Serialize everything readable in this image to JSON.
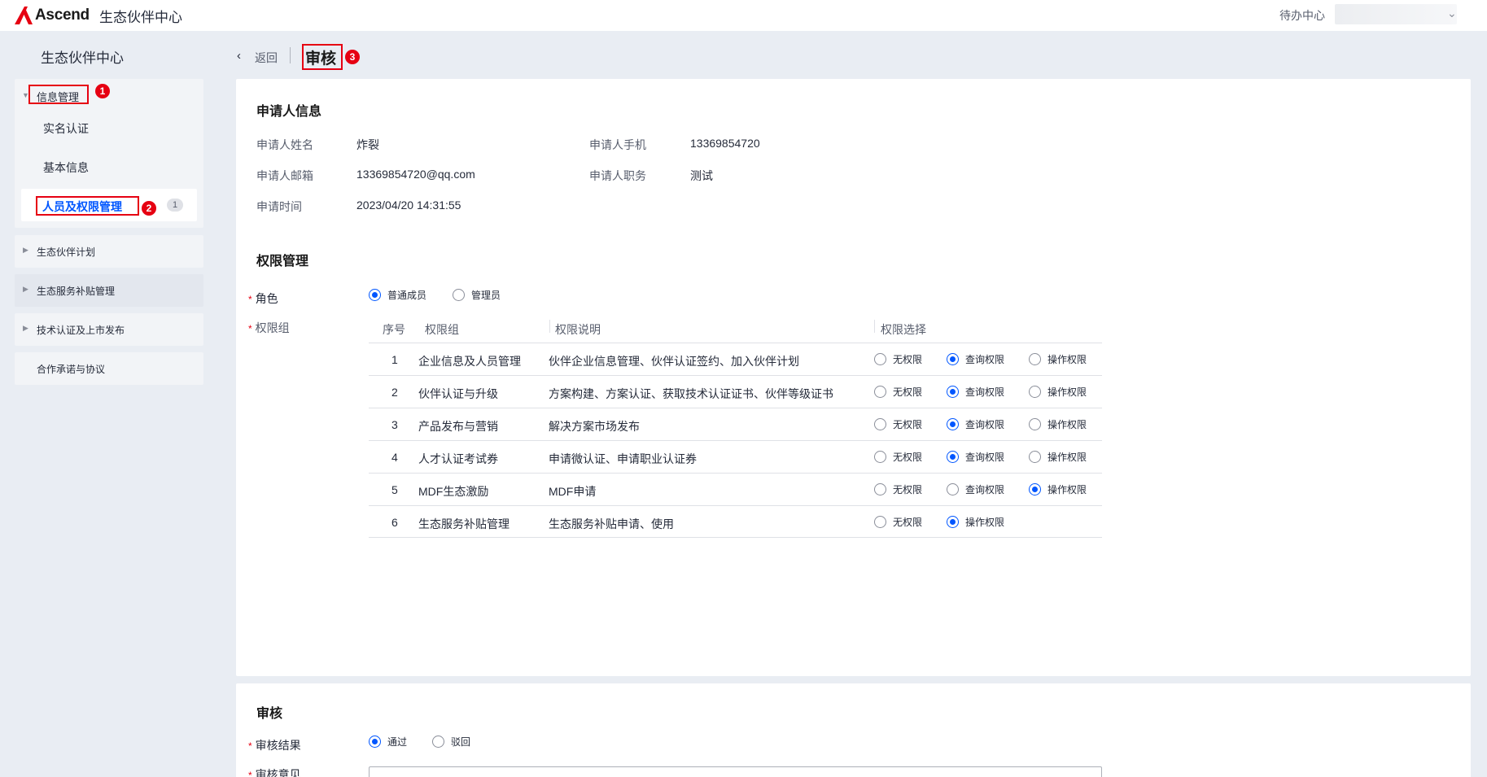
{
  "header": {
    "logo_text": "Ascend",
    "app_title": "生态伙伴中心",
    "todo_label": "待办中心",
    "brand_color": "#e60012"
  },
  "sidebar": {
    "title": "生态伙伴中心",
    "group_info": {
      "label": "信息管理",
      "items": [
        {
          "label": "实名认证"
        },
        {
          "label": "基本信息"
        },
        {
          "label": "人员及权限管理",
          "badge": "1",
          "active": true
        }
      ]
    },
    "groups": [
      {
        "label": "生态伙伴计划"
      },
      {
        "label": "生态服务补贴管理"
      },
      {
        "label": "技术认证及上市发布"
      },
      {
        "label": "合作承诺与协议"
      }
    ]
  },
  "annotations": [
    "1",
    "2",
    "3"
  ],
  "breadcrumb": {
    "back_label": "返回",
    "page_title": "审核"
  },
  "applicant": {
    "section_title": "申请人信息",
    "name_label": "申请人姓名",
    "name_value": "炸裂",
    "phone_label": "申请人手机",
    "phone_value": "13369854720",
    "email_label": "申请人邮箱",
    "email_value": "13369854720@qq.com",
    "position_label": "申请人职务",
    "position_value": "测试",
    "time_label": "申请时间",
    "time_value": "2023/04/20 14:31:55"
  },
  "permissions": {
    "section_title": "权限管理",
    "role_label": "角色",
    "role_options": [
      {
        "label": "普通成员",
        "checked": true
      },
      {
        "label": "管理员",
        "checked": false
      }
    ],
    "group_label": "权限组",
    "columns": {
      "index": "序号",
      "group": "权限组",
      "desc": "权限说明",
      "choice": "权限选择"
    },
    "rows": [
      {
        "index": "1",
        "group": "企业信息及人员管理",
        "desc": "伙伴企业信息管理、伙伴认证签约、加入伙伴计划",
        "options": [
          "无权限",
          "查询权限",
          "操作权限"
        ],
        "selected": 1
      },
      {
        "index": "2",
        "group": "伙伴认证与升级",
        "desc": "方案构建、方案认证、获取技术认证证书、伙伴等级证书",
        "options": [
          "无权限",
          "查询权限",
          "操作权限"
        ],
        "selected": 1
      },
      {
        "index": "3",
        "group": "产品发布与营销",
        "desc": "解决方案市场发布",
        "options": [
          "无权限",
          "查询权限",
          "操作权限"
        ],
        "selected": 1
      },
      {
        "index": "4",
        "group": "人才认证考试券",
        "desc": "申请微认证、申请职业认证券",
        "options": [
          "无权限",
          "查询权限",
          "操作权限"
        ],
        "selected": 1
      },
      {
        "index": "5",
        "group": "MDF生态激励",
        "desc": "MDF申请",
        "options": [
          "无权限",
          "查询权限",
          "操作权限"
        ],
        "selected": 2
      },
      {
        "index": "6",
        "group": "生态服务补贴管理",
        "desc": "生态服务补贴申请、使用",
        "options": [
          "无权限",
          "操作权限"
        ],
        "selected": 1
      }
    ]
  },
  "review": {
    "section_title": "审核",
    "result_label": "审核结果",
    "result_options": [
      {
        "label": "通过",
        "checked": true
      },
      {
        "label": "驳回",
        "checked": false
      }
    ],
    "opinion_label": "审核意见"
  }
}
